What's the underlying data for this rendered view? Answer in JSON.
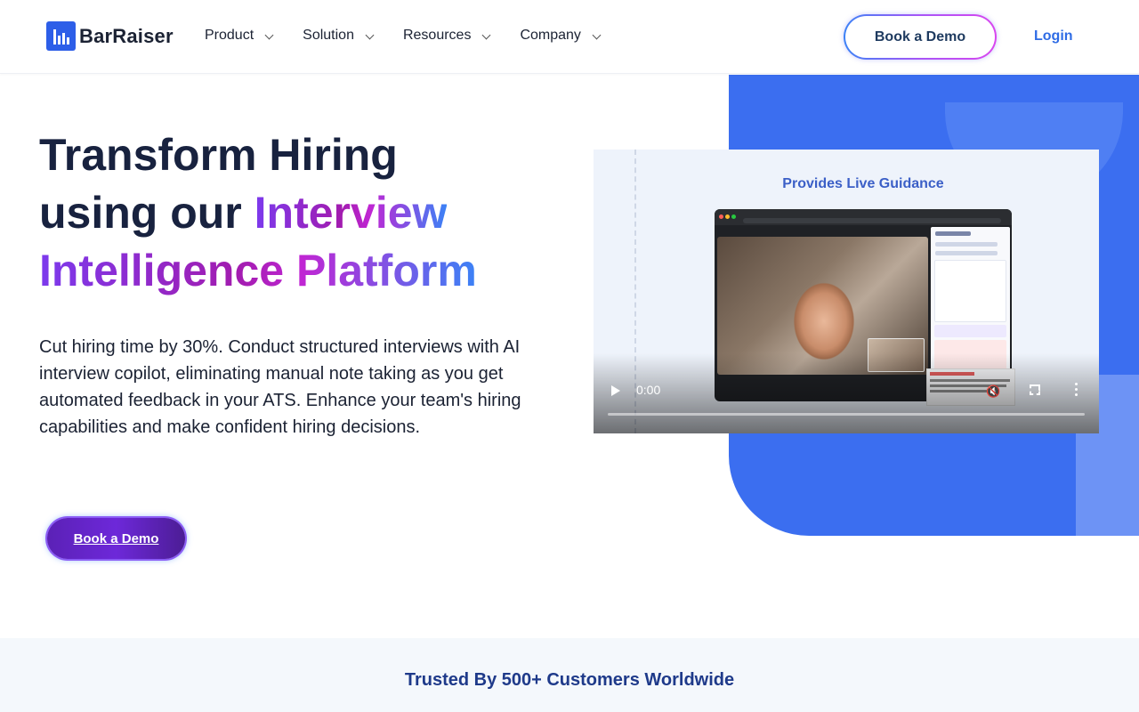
{
  "header": {
    "logo_text": "BarRaiser",
    "nav": [
      {
        "label": "Product"
      },
      {
        "label": "Solution"
      },
      {
        "label": "Resources"
      },
      {
        "label": "Company"
      }
    ],
    "book_demo_label": "Book a Demo",
    "login_label": "Login"
  },
  "hero": {
    "title_line1": "Transform Hiring",
    "title_line2_plain": "using our ",
    "title_line2_grad": "Interview",
    "title_line3_grad": "Intelligence Platform",
    "description": "Cut hiring time by 30%. Conduct structured interviews with AI interview copilot, eliminating manual note taking as you get automated feedback in your ATS. Enhance your team's hiring capabilities and make confident hiring decisions.",
    "cta_label": "Book a Demo"
  },
  "video": {
    "overlay_title": "Provides Live Guidance",
    "current_time": "0:00"
  },
  "trusted": {
    "title": "Trusted By 500+ Customers Worldwide"
  },
  "colors": {
    "brand_blue": "#2d5ee8",
    "hero_panel": "#3b6ef0",
    "cta_purple": "#6d28d9",
    "login_blue": "#2f6ce5"
  }
}
